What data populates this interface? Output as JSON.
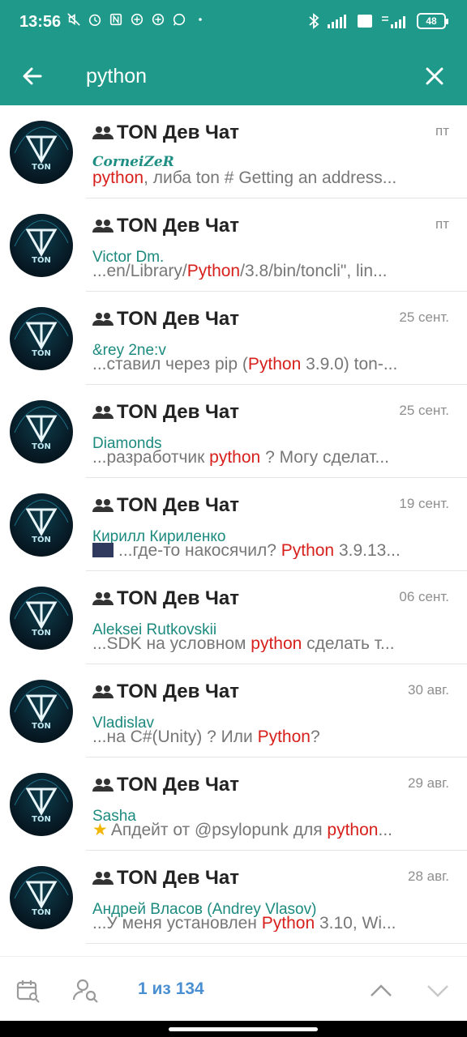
{
  "status_bar": {
    "time": "13:56",
    "battery": "48",
    "icons": [
      "mute-icon",
      "alarm-icon",
      "nfc-icon",
      "notification-icon",
      "notification-icon",
      "whatsapp-icon",
      "bluetooth-icon",
      "signal-icon",
      "volte-icon",
      "signal-4g-icon"
    ]
  },
  "header": {
    "query": "python",
    "back_icon": "arrow-left-icon",
    "close_icon": "close-icon",
    "color": "#1f9a8a"
  },
  "results": [
    {
      "chat": "TON Дев Чат",
      "date": "пт",
      "sender": "CorneiZeR",
      "sender_suffix": "͝ ͡",
      "msg_pre": "",
      "msg_hl": "python",
      "msg_post": ", либа ton # Getting an address..."
    },
    {
      "chat": "TON Дев Чат",
      "date": "пт",
      "sender": "Victor Dm.",
      "msg_pre": "...en/Library/",
      "msg_hl": "Python",
      "msg_post": "/3.8/bin/toncli\", lin..."
    },
    {
      "chat": "TON Дев Чат",
      "date": "25 сент.",
      "sender": "&rey 2ne:v",
      "msg_pre": "...ставил через pip (",
      "msg_hl": "Python",
      "msg_post": " 3.9.0) ton-..."
    },
    {
      "chat": "TON Дев Чат",
      "date": "25 сент.",
      "sender": "Diamonds",
      "msg_pre": "...разработчик ",
      "msg_hl": "python",
      "msg_post": " ? Могу сделат..."
    },
    {
      "chat": "TON Дев Чат",
      "date": "19 сент.",
      "sender": "Кирилл Кириленко",
      "msg_pre": "...где-то накосячил? ",
      "msg_hl": "Python",
      "msg_post": " 3.9.13..."
    },
    {
      "chat": "TON Дев Чат",
      "date": "06 сент.",
      "sender": "Aleksei Rutkovskii",
      "msg_pre": "...SDK на условном ",
      "msg_hl": "python",
      "msg_post": " сделать т..."
    },
    {
      "chat": "TON Дев Чат",
      "date": "30 авг.",
      "sender": "Vladislav",
      "msg_pre": "...на C#(Unity) ? Или ",
      "msg_hl": "Python",
      "msg_post": "?"
    },
    {
      "chat": "TON Дев Чат",
      "date": "29 авг.",
      "sender": "Sasha",
      "msg_pre": "Апдейт от @psylopunk для ",
      "msg_hl": "python",
      "msg_post": "..."
    },
    {
      "chat": "TON Дев Чат",
      "date": "28 авг.",
      "sender": "Андрей Власов (Andrey Vlasov)",
      "msg_pre": "...У меня установлен ",
      "msg_hl": "Python",
      "msg_post": " 3.10, Wi..."
    }
  ],
  "avatar_text": "TON",
  "bottom_bar": {
    "counter": "1 из 134",
    "calendar_icon": "calendar-search-icon",
    "user_icon": "user-search-icon",
    "up_icon": "chevron-up-icon",
    "down_icon": "chevron-down-icon"
  },
  "colors": {
    "accent": "#1f9a8a",
    "highlight": "#d7201c",
    "sender": "#1c8a7e",
    "counter": "#4a8fd1"
  }
}
